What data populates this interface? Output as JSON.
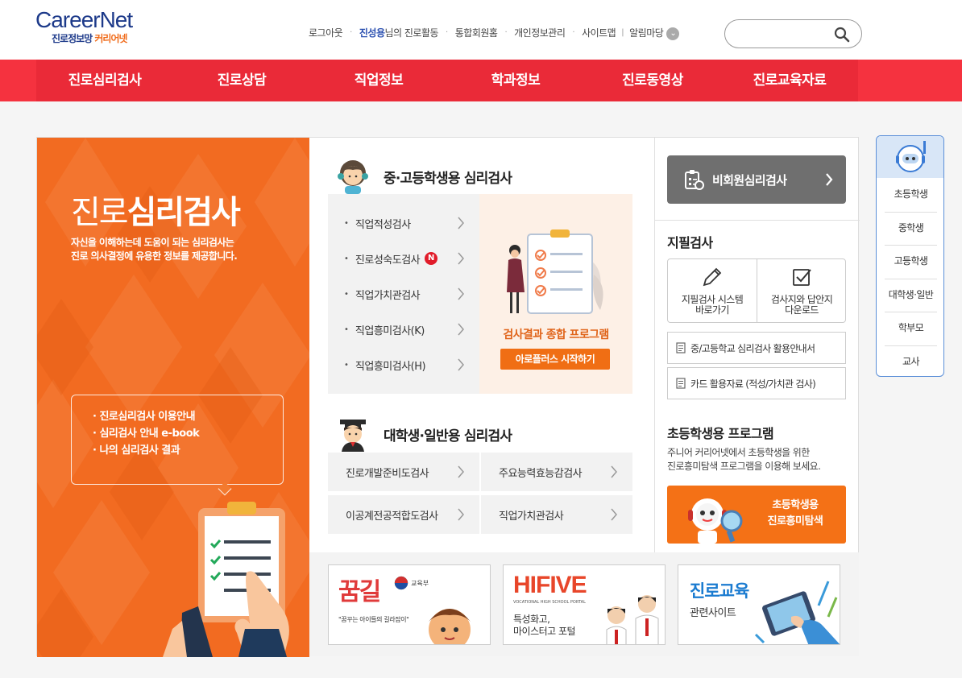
{
  "header": {
    "logo_brand": "CareerNet",
    "logo_sub_1": "진로정보망",
    "logo_sub_2": "커리어넷",
    "topnav": {
      "logout": "로그아웃",
      "user_name": "진성용",
      "user_suffix": "님의 진로활동",
      "integrated_member": "통합회원홈",
      "personal_info": "개인정보관리",
      "sitemap": "사이트맵",
      "notice": "알림마당"
    },
    "search_placeholder": ""
  },
  "main_nav": [
    "진로심리검사",
    "진로상담",
    "직업정보",
    "학과정보",
    "진로동영상",
    "진로교육자료"
  ],
  "hero": {
    "title_thin": "진로",
    "title_bold": "심리검사",
    "desc_1": "자신을 이해하는데 도움이 되는 심리검사는",
    "desc_2": "진로 의사결정에 유용한 정보를 제공합니다.",
    "links": [
      "· 진로심리검사 이용안내",
      "· 심리검사 안내 e-book",
      "· 나의 심리검사 결과"
    ]
  },
  "secondary": {
    "title": "중·고등학생용 심리검사",
    "tests": [
      {
        "label": "직업적성검사",
        "new": ""
      },
      {
        "label": "진로성숙도검사",
        "new": "N"
      },
      {
        "label": "직업가치관검사",
        "new": ""
      },
      {
        "label": "직업흥미검사(K)",
        "new": ""
      },
      {
        "label": "직업흥미검사(H)",
        "new": ""
      }
    ],
    "promo_text": "검사결과 종합 프로그램",
    "promo_button": "아로플러스 시작하기"
  },
  "adult": {
    "title": "대학생·일반용 심리검사",
    "tests": [
      "진로개발준비도검사",
      "주요능력효능감검사",
      "이공계전공적합도검사",
      "직업가치관검사"
    ]
  },
  "right": {
    "nonmember": "비회원심리검사",
    "paper_title": "지필검사",
    "paper_1_line1": "지필검사 시스템",
    "paper_1_line2": "바로가기",
    "paper_2_line1": "검사지와 답안지",
    "paper_2_line2": "다운로드",
    "doc_1": "중/고등학교 심리검사 활용안내서",
    "doc_2": "카드 활용자료 (적성/가치관 검사)",
    "elem_title": "초등학생용 프로그램",
    "elem_desc_1": "주니어 커리어넷에서 초등학생을 위한",
    "elem_desc_2": "진로흥미탐색 프로그램을 이용해 보세요.",
    "elem_btn_1": "초등학생용",
    "elem_btn_2": "진로흥미탐색"
  },
  "banners": {
    "b1_title": "꿈길",
    "b1_ministry": "교육부",
    "b1_tag": "\"꿈꾸는 아이들의 길라잡이\"",
    "b2_title": "HIFIVE",
    "b2_portal": "VOCATIONAL HIGH SCHOOL PORTAL",
    "b2_sub_1": "특성화고,",
    "b2_sub_2": "마이스터고 포털",
    "b3_title": "진로교육",
    "b3_sub": "관련사이트"
  },
  "quick_menu": [
    "초등학생",
    "중학생",
    "고등학생",
    "대학생·일반",
    "학부모",
    "교사"
  ],
  "colors": {
    "nav_red": "#ea2a38",
    "hero_orange": "#f26b21",
    "brand_blue": "#1d3a8a",
    "promo_orange": "#f06e14"
  }
}
